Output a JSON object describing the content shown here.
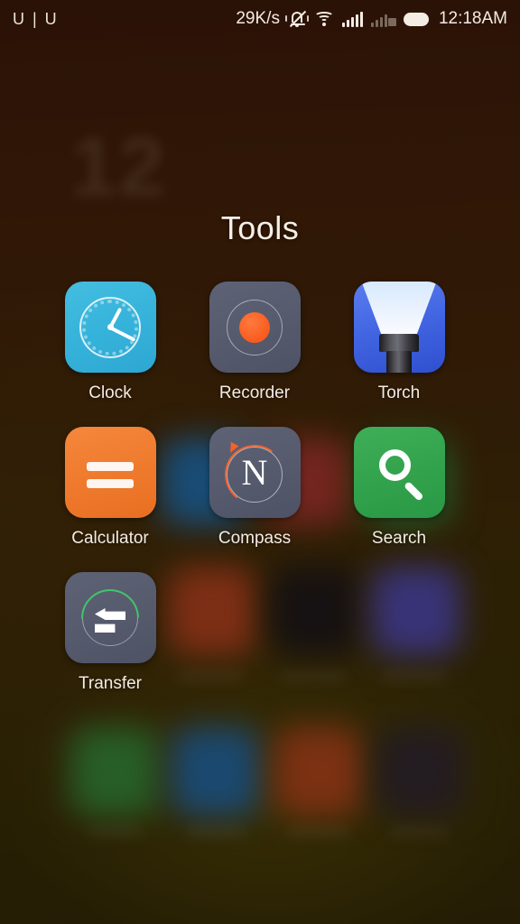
{
  "status_bar": {
    "carrier": "U | U",
    "network_speed": "29K/s",
    "time": "12:18AM",
    "icons": [
      {
        "name": "mute-vibrate-icon",
        "label": "Silent / vibrate"
      },
      {
        "name": "wifi-icon",
        "label": "Wi-Fi connected"
      },
      {
        "name": "signal-icon-sim1",
        "label": "SIM 1 signal full"
      },
      {
        "name": "signal-icon-sim2-no-service",
        "label": "SIM 2 no service"
      },
      {
        "name": "battery-icon",
        "label": "Battery full"
      }
    ],
    "no_service_marker": "×"
  },
  "folder": {
    "title": "Tools",
    "apps": [
      {
        "label": "Clock",
        "icon": "clock-icon",
        "color": "#35b2da"
      },
      {
        "label": "Recorder",
        "icon": "recorder-icon",
        "color": "#565a6d"
      },
      {
        "label": "Torch",
        "icon": "torch-icon",
        "color": "#4265e2"
      },
      {
        "label": "Calculator",
        "icon": "calculator-icon",
        "color": "#ef7a2d"
      },
      {
        "label": "Compass",
        "icon": "compass-icon",
        "color": "#565a6d"
      },
      {
        "label": "Search",
        "icon": "search-icon",
        "color": "#32a34c"
      },
      {
        "label": "Transfer",
        "icon": "transfer-icon",
        "color": "#565a6d"
      }
    ]
  },
  "background": {
    "widget_clock_hour": "12",
    "widget_clock_sub": "",
    "wallpaper_top_color": "#351708",
    "wallpaper_bottom_color": "#2b2705"
  },
  "theme": {
    "text_color": "#f4ece2",
    "status_text_color": "#f3ece4",
    "scrim_color": "rgba(24,10,3,0.34)"
  }
}
